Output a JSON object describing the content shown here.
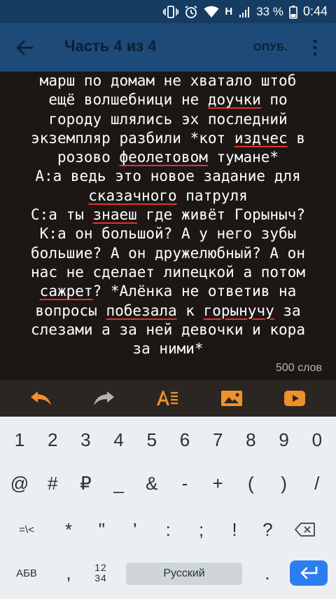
{
  "status": {
    "net": "H",
    "battery": "33 %",
    "time": "0:44"
  },
  "appbar": {
    "title": "Часть 4 из 4",
    "publish_label": "ОПУБ."
  },
  "editor": {
    "lines": [
      [
        {
          "t": "марш по домам не хватало штоб"
        }
      ],
      [
        {
          "t": "ещё волшебници не "
        },
        {
          "t": "доучки",
          "s": true
        },
        {
          "t": " по"
        }
      ],
      [
        {
          "t": "городу шлялись эх последний"
        }
      ],
      [
        {
          "t": "экземпляр разбили *кот "
        },
        {
          "t": "издчес",
          "s": true
        },
        {
          "t": " в"
        }
      ],
      [
        {
          "t": "розово "
        },
        {
          "t": "феолетовом",
          "s": true
        },
        {
          "t": " тумане*"
        }
      ],
      [
        {
          "t": "А:а ведь это новое задание для"
        }
      ],
      [
        {
          "t": "сказачного",
          "s": true
        },
        {
          "t": " патруля"
        }
      ],
      [
        {
          "t": "С:а ты "
        },
        {
          "t": "знаеш",
          "s": true
        },
        {
          "t": " где живёт Горыныч?"
        }
      ],
      [
        {
          "t": "К:а он большой? А у него зубы"
        }
      ],
      [
        {
          "t": "большие? А он дружелюбный? А он"
        }
      ],
      [
        {
          "t": "нас не сделает липецкой а потом"
        }
      ],
      [
        {
          "t": "сажрет",
          "s": true
        },
        {
          "t": "? *Алёнка не ответив на"
        }
      ],
      [
        {
          "t": "вопросы "
        },
        {
          "t": "побезала",
          "s": true
        },
        {
          "t": " к "
        },
        {
          "t": "горынучу",
          "s": true
        },
        {
          "t": " за"
        }
      ],
      [
        {
          "t": "слезами а за ней девочки и кора"
        }
      ],
      [
        {
          "t": "за ними*"
        }
      ]
    ],
    "word_count": "500 слов"
  },
  "toolbar": {
    "icons": [
      "undo-icon",
      "redo-icon",
      "text-format-icon",
      "insert-image-icon",
      "insert-video-icon"
    ],
    "accent": "#f0902a"
  },
  "keyboard": {
    "row1": [
      "1",
      "2",
      "3",
      "4",
      "5",
      "6",
      "7",
      "8",
      "9",
      "0"
    ],
    "row2": [
      "@",
      "#",
      "₽",
      "_",
      "&",
      "-",
      "+",
      "(",
      ")",
      "/"
    ],
    "row3_switch": "=\\<",
    "row3": [
      "*",
      "\"",
      "'",
      ":",
      ";",
      "!",
      "?"
    ],
    "abc_label": "АБВ",
    "comma": ",",
    "frac_top": "12",
    "frac_bottom": "34",
    "space_label": "Русский",
    "period": "."
  }
}
